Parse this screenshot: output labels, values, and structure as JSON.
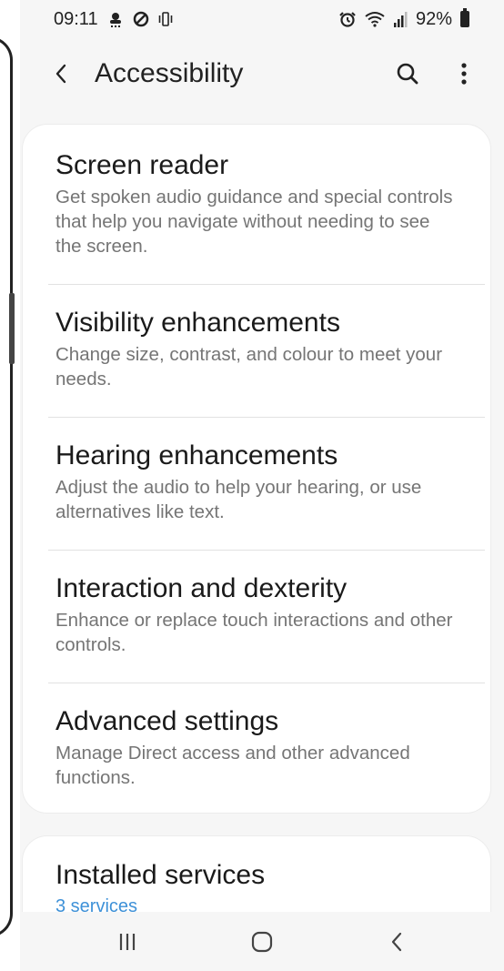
{
  "status_bar": {
    "time": "09:11",
    "battery_percent": "92%",
    "icons_left": [
      "weather-icon",
      "blocked-icon",
      "vibrate-icon"
    ],
    "icons_right": [
      "alarm-icon",
      "wifi-icon",
      "signal-icon",
      "battery-icon"
    ]
  },
  "toolbar": {
    "title": "Accessibility",
    "back_icon": "chevron-left-icon",
    "search_icon": "search-icon",
    "more_icon": "more-vertical-icon"
  },
  "menu": {
    "items": [
      {
        "title": "Screen reader",
        "description": "Get spoken audio guidance and special controls that help you navigate without needing to see the screen."
      },
      {
        "title": "Visibility enhancements",
        "description": "Change size, contrast, and colour to meet your needs."
      },
      {
        "title": "Hearing enhancements",
        "description": "Adjust the audio to help your hearing, or use alternatives like text."
      },
      {
        "title": "Interaction and dexterity",
        "description": "Enhance or replace touch interactions and other controls."
      },
      {
        "title": "Advanced settings",
        "description": "Manage Direct access and other advanced functions."
      }
    ]
  },
  "installed": {
    "title": "Installed services",
    "subtitle": "3 services"
  },
  "nav_bar": {
    "recents_icon": "recents-icon",
    "home_icon": "home-icon",
    "back_icon": "back-icon"
  },
  "colors": {
    "background": "#f6f6f6",
    "card": "#ffffff",
    "title_text": "#1a1a1a",
    "description_text": "#757575",
    "link_blue": "#3e91d8"
  }
}
